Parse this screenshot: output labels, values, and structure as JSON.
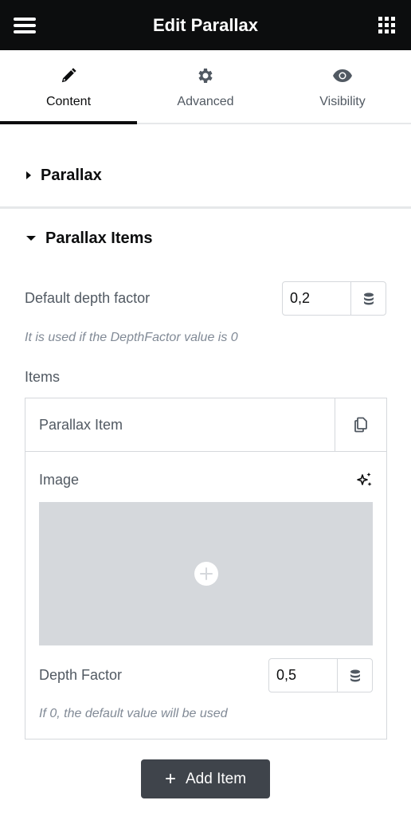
{
  "header": {
    "title": "Edit Parallax",
    "menu_icon": "hamburger-icon",
    "apps_icon": "grid-icon"
  },
  "tabs": [
    {
      "label": "Content",
      "icon": "pencil-icon",
      "active": true
    },
    {
      "label": "Advanced",
      "icon": "gear-icon",
      "active": false
    },
    {
      "label": "Visibility",
      "icon": "eye-icon",
      "active": false
    }
  ],
  "sections": [
    {
      "title": "Parallax",
      "expanded": false
    },
    {
      "title": "Parallax Items",
      "expanded": true
    }
  ],
  "default_depth": {
    "label": "Default depth factor",
    "value": "0,2",
    "hint": "It is used if the DepthFactor value is 0",
    "dynamic_icon": "database-icon"
  },
  "items": {
    "label": "Items",
    "list": [
      {
        "title": "Parallax Item",
        "duplicate_icon": "copy-icon",
        "image_label": "Image",
        "ai_icon": "sparkles-icon",
        "depth_label": "Depth Factor",
        "depth_value": "0,5",
        "depth_hint": "If 0, the default value will be used"
      }
    ],
    "add_button": "Add Item"
  },
  "colors": {
    "header_bg": "#0c0d0e",
    "button_bg": "#3f444b",
    "placeholder_bg": "#d5d8dc",
    "border": "#d5d8dc"
  }
}
